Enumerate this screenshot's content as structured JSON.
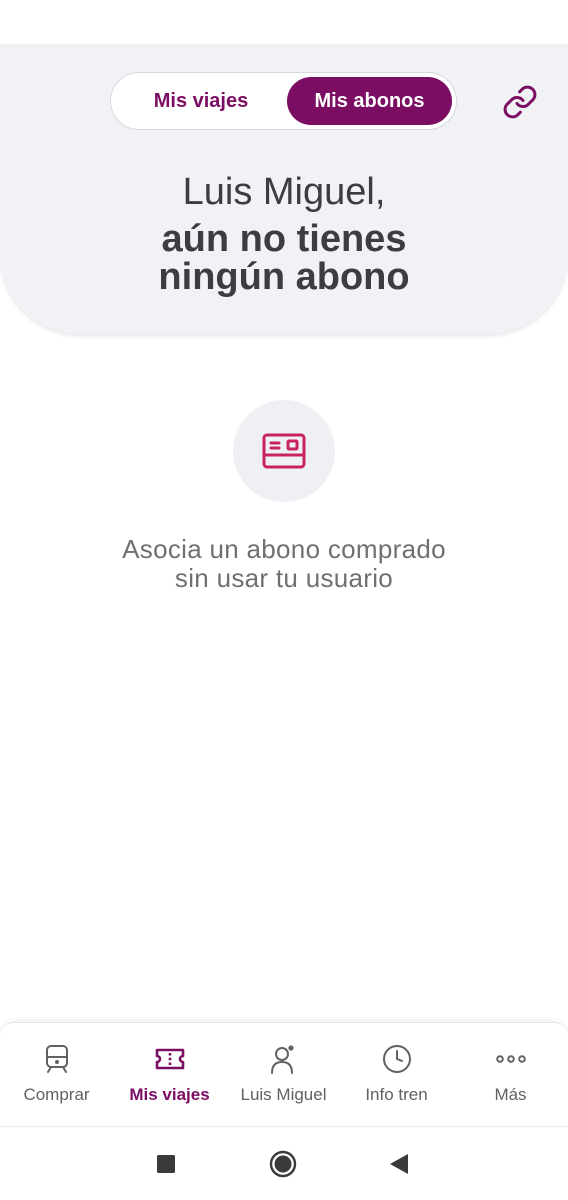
{
  "header": {
    "tabs": {
      "trips": "Mis viajes",
      "passes": "Mis abonos"
    },
    "greeting": "Luis Miguel,",
    "headline_line1": "aún no tienes",
    "headline_line2": "ningún abono"
  },
  "empty_state": {
    "line1": "Asocia un abono comprado",
    "line2": "sin usar tu usuario"
  },
  "bottom_nav": {
    "items": [
      {
        "label": "Comprar",
        "icon": "train-icon"
      },
      {
        "label": "Mis viajes",
        "icon": "ticket-icon",
        "active": true
      },
      {
        "label": "Luis Miguel",
        "icon": "user-icon"
      },
      {
        "label": "Info tren",
        "icon": "clock-icon"
      },
      {
        "label": "Más",
        "icon": "more-icon"
      }
    ]
  },
  "colors": {
    "brand": "#7b0d63",
    "pass_icon": "#c8235d",
    "header_bg": "#f0f2f5",
    "text_dark": "#3b3d40",
    "text_muted": "#6e7074"
  }
}
